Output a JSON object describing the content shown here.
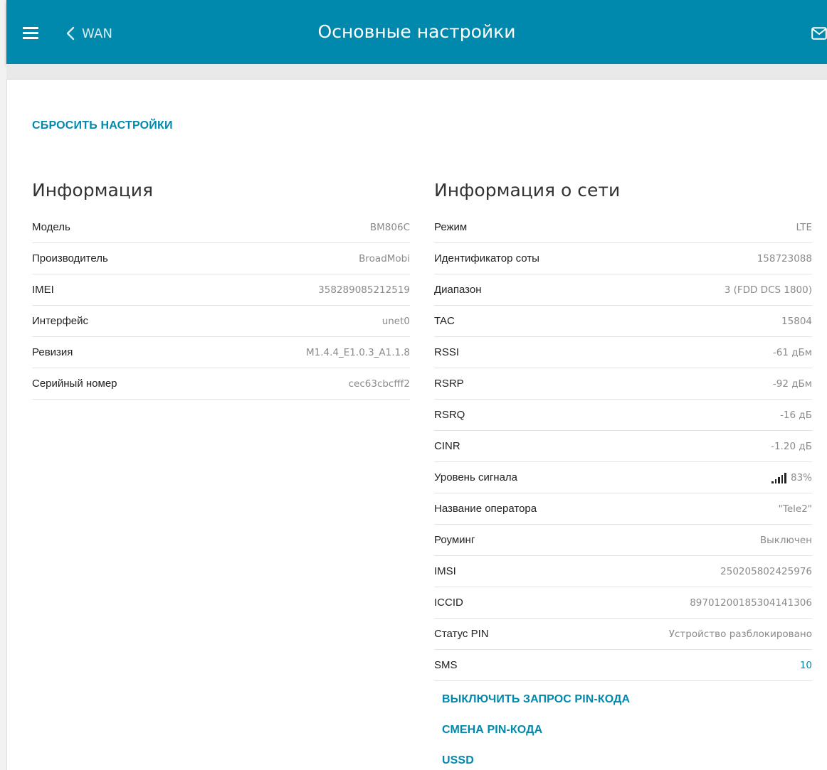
{
  "header": {
    "back_label": "WAN",
    "title": "Основные настройки",
    "color": "#0089ad"
  },
  "reset_label": "СБРОСИТЬ НАСТРОЙКИ",
  "info": {
    "title": "Информация",
    "rows": [
      {
        "label": "Модель",
        "value": "BM806C"
      },
      {
        "label": "Производитель",
        "value": "BroadMobi"
      },
      {
        "label": "IMEI",
        "value": "358289085212519"
      },
      {
        "label": "Интерфейс",
        "value": "unet0"
      },
      {
        "label": "Ревизия",
        "value": "M1.4.4_E1.0.3_A1.1.8"
      },
      {
        "label": "Серийный номер",
        "value": "cec63cbcfff2"
      }
    ]
  },
  "network": {
    "title": "Информация о сети",
    "rows": [
      {
        "label": "Режим",
        "value": "LTE"
      },
      {
        "label": "Идентификатор соты",
        "value": "158723088"
      },
      {
        "label": "Диапазон",
        "value": "3 (FDD DCS 1800)"
      },
      {
        "label": "TAC",
        "value": "15804"
      },
      {
        "label": "RSSI",
        "value": "-61 дБм"
      },
      {
        "label": "RSRP",
        "value": "-92 дБм"
      },
      {
        "label": "RSRQ",
        "value": "-16 дБ"
      },
      {
        "label": "CINR",
        "value": "-1.20 дБ"
      },
      {
        "label": "Уровень сигнала",
        "value": "83%"
      },
      {
        "label": "Название оператора",
        "value": "\"Tele2\""
      },
      {
        "label": "Роуминг",
        "value": "Выключен"
      },
      {
        "label": "IMSI",
        "value": "250205802425976"
      },
      {
        "label": "ICCID",
        "value": "89701200185304141306"
      },
      {
        "label": "Статус PIN",
        "value": "Устройство разблокировано"
      },
      {
        "label": "SMS",
        "value": "10"
      }
    ]
  },
  "actions": {
    "disable_pin": "ВЫКЛЮЧИТЬ ЗАПРОС PIN-КОДА",
    "change_pin": "СМЕНА PIN-КОДА",
    "ussd": "USSD"
  },
  "icons": {
    "menu": "hamburger-menu-icon",
    "back": "chevron-left-icon",
    "mail": "mail-icon",
    "signal": "signal-bars-icon"
  }
}
